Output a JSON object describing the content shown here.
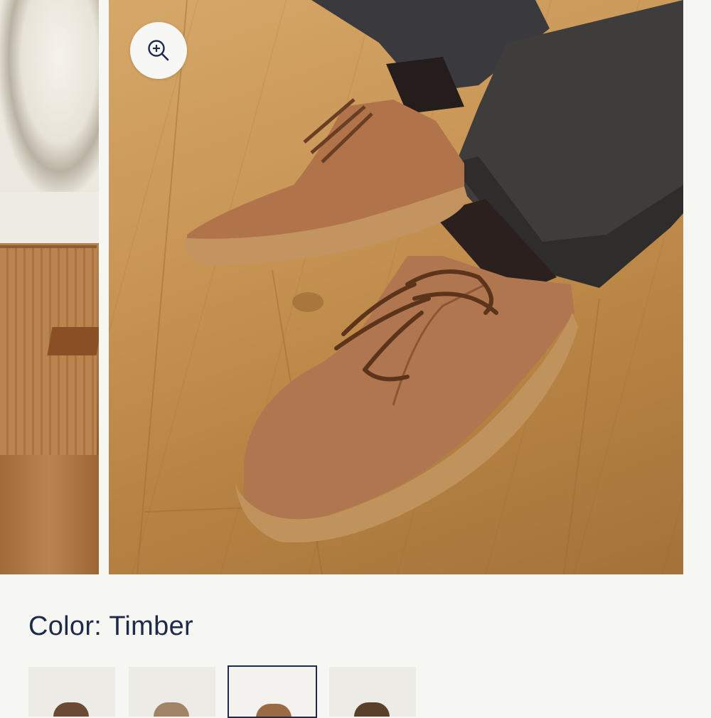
{
  "gallery": {
    "images": [
      {
        "name": "previous-lifestyle-image"
      },
      {
        "name": "main-product-image"
      }
    ],
    "zoom_icon": "zoom-in-icon"
  },
  "product": {
    "color_label": "Color: Timber",
    "selected_color": "Timber",
    "swatches": [
      {
        "shoe_color": "#6b4a34"
      },
      {
        "shoe_color": "#a08466"
      },
      {
        "shoe_color": "#9a6a45",
        "selected": true
      },
      {
        "shoe_color": "#5a3f2a"
      }
    ]
  },
  "colors": {
    "text_primary": "#1e2a4a",
    "background": "#f6f6f2",
    "swatch_bg": "#ecebe6"
  }
}
